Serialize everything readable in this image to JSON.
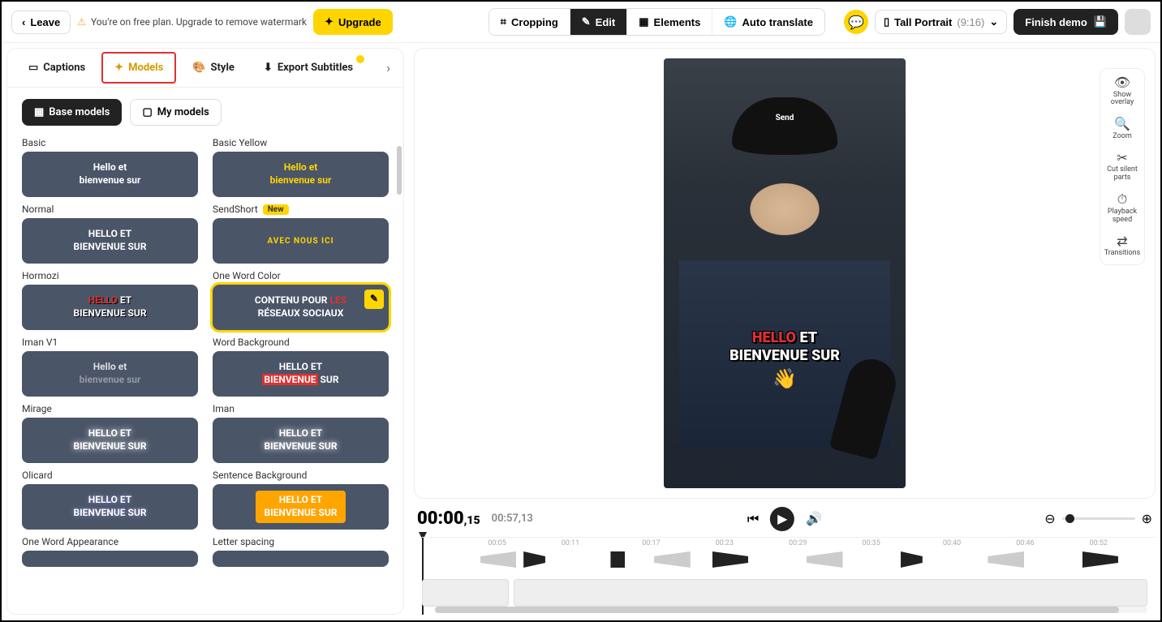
{
  "topbar": {
    "leave": "Leave",
    "plan_warning": "You're on free plan. Upgrade to remove watermark",
    "upgrade": "Upgrade",
    "cropping": "Cropping",
    "edit": "Edit",
    "elements": "Elements",
    "auto_translate": "Auto translate",
    "ratio_label": "Tall Portrait",
    "ratio_dim": "(9:16)",
    "finish": "Finish demo"
  },
  "tabs": {
    "captions": "Captions",
    "models": "Models",
    "style": "Style",
    "export_subtitles": "Export Subtitles"
  },
  "subtabs": {
    "base": "Base models",
    "my": "My models"
  },
  "models": {
    "basic": {
      "label": "Basic",
      "line1": "Hello et",
      "line2": "bienvenue sur"
    },
    "basic_yellow": {
      "label": "Basic Yellow",
      "line1": "Hello et",
      "line2": "bienvenue sur"
    },
    "normal": {
      "label": "Normal",
      "line1": "HELLO ET",
      "line2": "BIENVENUE SUR"
    },
    "sendshort": {
      "label": "SendShort",
      "new": "New",
      "text": "AVEC NOUS ICI"
    },
    "hormozi": {
      "label": "Hormozi",
      "w1": "HELLO",
      "w2": "ET",
      "line2": "BIENVENUE SUR"
    },
    "owc": {
      "label": "One Word Color",
      "line1a": "CONTENU POUR ",
      "line1b": "LES",
      "line2": "RÉSEAUX SOCIAUX"
    },
    "iman_v1": {
      "label": "Iman V1",
      "line1": "Hello et",
      "line2": "bienvenue sur"
    },
    "word_bg": {
      "label": "Word Background",
      "w1": "HELLO",
      "w2": "ET",
      "line2a": "BIENVENUE",
      "line2b": " SUR"
    },
    "mirage": {
      "label": "Mirage",
      "line1": "HELLO ET",
      "line2": "BIENVENUE SUR"
    },
    "iman": {
      "label": "Iman",
      "line1": "HELLO ET",
      "line2": "BIENVENUE SUR"
    },
    "olicard": {
      "label": "Olicard",
      "line1": "HELLO ET",
      "line2": "BIENVENUE SUR"
    },
    "sent_bg": {
      "label": "Sentence Background",
      "line1": "HELLO ET",
      "line2": "BIENVENUE SUR"
    },
    "owa": {
      "label": "One Word Appearance"
    },
    "letter_spacing": {
      "label": "Letter spacing"
    }
  },
  "caption_overlay": {
    "hello": "HELLO",
    "et": " ET",
    "line2": "BIENVENUE SUR",
    "emoji": "👋"
  },
  "cap_logo": "Send",
  "right_tools": {
    "overlay": "Show overlay",
    "zoom": "Zoom",
    "cut": "Cut silent parts",
    "speed": "Playback speed",
    "transitions": "Transitions"
  },
  "playback": {
    "current": "00:00",
    "current_frac": ",15",
    "duration": "00:57",
    "duration_frac": ",13"
  },
  "timeline_ticks": [
    "00:05",
    "00:11",
    "00:17",
    "00:23",
    "00:29",
    "00:35",
    "00:40",
    "00:46",
    "00:52"
  ]
}
